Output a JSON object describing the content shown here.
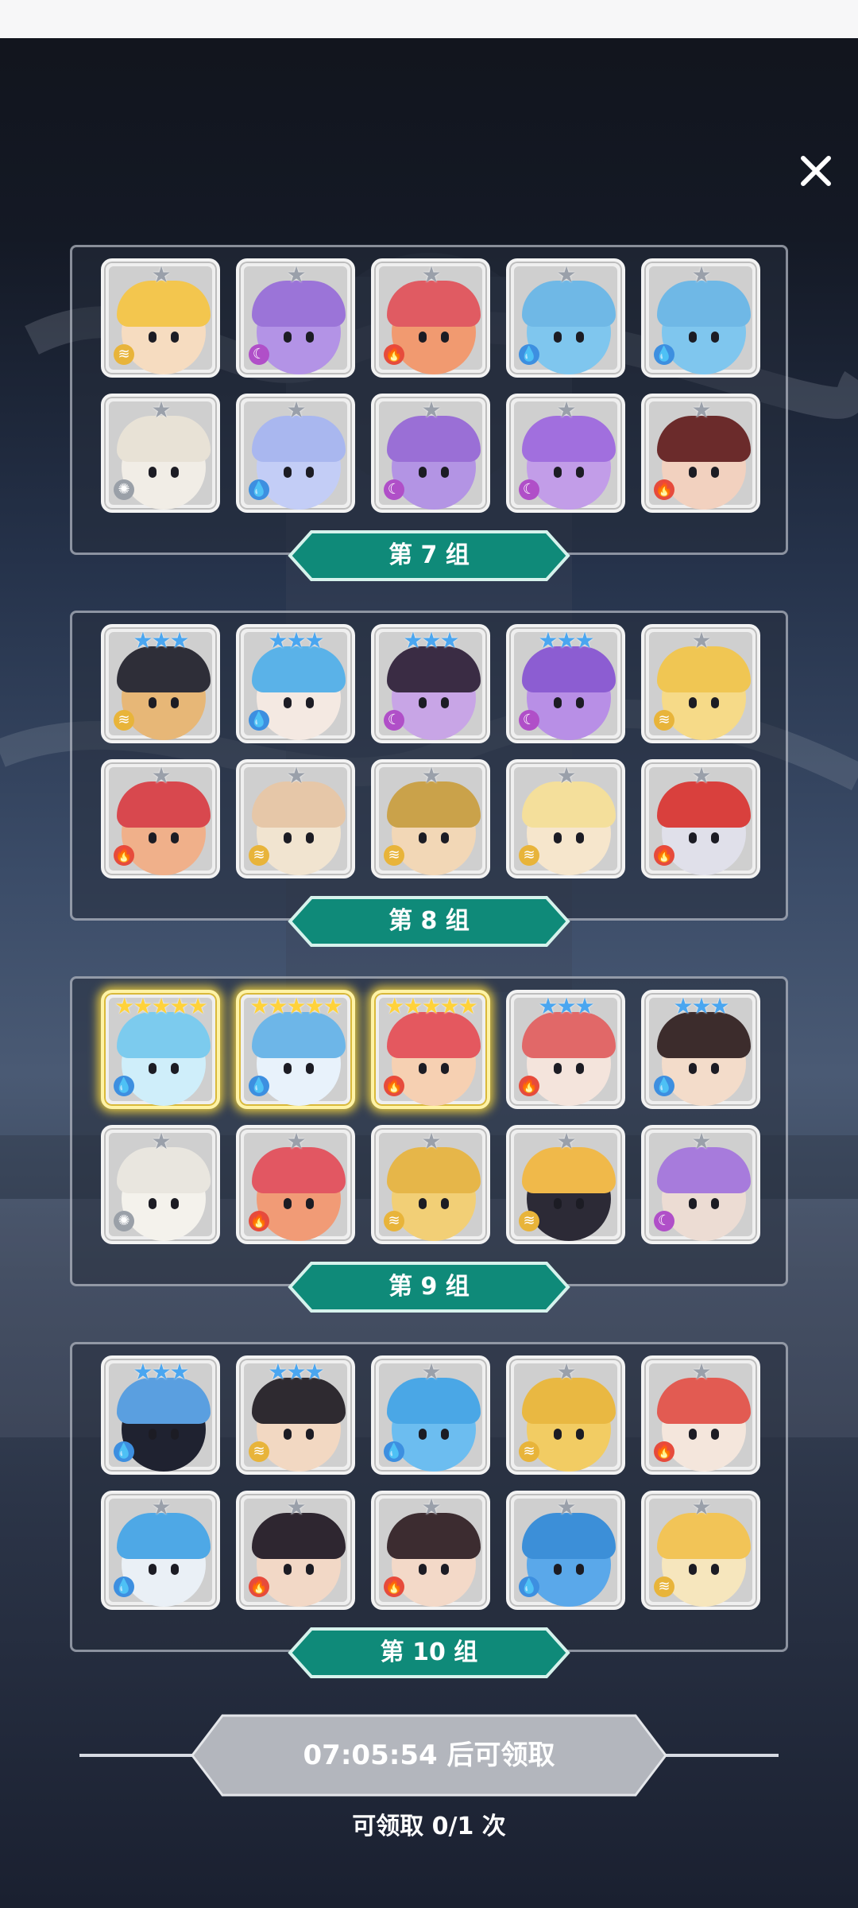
{
  "close_icon": "close-icon",
  "groups": [
    {
      "label": "第 7 组",
      "cards": [
        {
          "stars": "★",
          "element": "wind",
          "palette": [
            "#f3c64e",
            "#f6dcc0",
            "#e7a13a"
          ]
        },
        {
          "stars": "★",
          "element": "dark",
          "palette": [
            "#9b74d8",
            "#b393e6",
            "#7c55c0"
          ]
        },
        {
          "stars": "★",
          "element": "fire",
          "palette": [
            "#e05b62",
            "#f19a70",
            "#c94550"
          ]
        },
        {
          "stars": "★",
          "element": "water",
          "palette": [
            "#6fb8e6",
            "#7fc6ee",
            "#5aa1d6"
          ]
        },
        {
          "stars": "★",
          "element": "water",
          "palette": [
            "#6fb8e6",
            "#7fc6ee",
            "#5aa1d6"
          ]
        },
        {
          "stars": "★",
          "element": "light",
          "palette": [
            "#e8e2d6",
            "#f1ede6",
            "#cfc7b8"
          ]
        },
        {
          "stars": "★",
          "element": "water",
          "palette": [
            "#a9b7ef",
            "#c3cdf6",
            "#8a9be0"
          ]
        },
        {
          "stars": "★",
          "element": "dark",
          "palette": [
            "#9a6fd6",
            "#b394e4",
            "#7a52bd"
          ]
        },
        {
          "stars": "★",
          "element": "dark",
          "palette": [
            "#a16fde",
            "#c29de8",
            "#4a2d66"
          ]
        },
        {
          "stars": "★",
          "element": "fire",
          "palette": [
            "#6b2b2b",
            "#f2d1bf",
            "#d9463e"
          ]
        }
      ]
    },
    {
      "label": "第 8 组",
      "cards": [
        {
          "stars": "★★★",
          "element": "wind",
          "palette": [
            "#2e2e38",
            "#e7b777",
            "#f0d9b0"
          ]
        },
        {
          "stars": "★★★",
          "element": "water",
          "palette": [
            "#5ab2e8",
            "#f4e9e2",
            "#2e7fc0"
          ]
        },
        {
          "stars": "★★★",
          "element": "dark",
          "palette": [
            "#3a2c44",
            "#c8a5e6",
            "#8a5cc6"
          ]
        },
        {
          "stars": "★★★",
          "element": "dark",
          "palette": [
            "#8c5dd2",
            "#b88fe6",
            "#6b3fb0"
          ]
        },
        {
          "stars": "★",
          "element": "wind",
          "palette": [
            "#f0c653",
            "#f6da88",
            "#d6a733"
          ]
        },
        {
          "stars": "★",
          "element": "fire",
          "palette": [
            "#d8484e",
            "#f0b08a",
            "#b5363c"
          ]
        },
        {
          "stars": "★",
          "element": "wind",
          "palette": [
            "#e6c7a8",
            "#f1e4d0",
            "#c9a37f"
          ]
        },
        {
          "stars": "★",
          "element": "wind",
          "palette": [
            "#caa24a",
            "#f2d7b6",
            "#2f2f38"
          ]
        },
        {
          "stars": "★",
          "element": "wind",
          "palette": [
            "#f4df9b",
            "#f6e6cc",
            "#e6c768"
          ]
        },
        {
          "stars": "★",
          "element": "fire",
          "palette": [
            "#d9403d",
            "#e0e0ea",
            "#2e2e3c"
          ]
        }
      ]
    },
    {
      "label": "第 9 组",
      "cards": [
        {
          "stars": "★★★★★",
          "element": "water",
          "gold": true,
          "palette": [
            "#7ccbee",
            "#cfeefa",
            "#2e3c5a"
          ]
        },
        {
          "stars": "★★★★★",
          "element": "water",
          "gold": true,
          "palette": [
            "#6db6e8",
            "#e8f2fb",
            "#3b7fc1"
          ]
        },
        {
          "stars": "★★★★★",
          "element": "fire",
          "gold": true,
          "palette": [
            "#e4585f",
            "#f6d0b2",
            "#c23f48"
          ]
        },
        {
          "stars": "★★★",
          "element": "fire",
          "palette": [
            "#e16868",
            "#f4e4dc",
            "#c44b4b"
          ]
        },
        {
          "stars": "★★★",
          "element": "water",
          "palette": [
            "#3c2c2c",
            "#f3dcca",
            "#5d9ee0"
          ]
        },
        {
          "stars": "★",
          "element": "light",
          "palette": [
            "#e9e6df",
            "#f4f2ec",
            "#c9c4b8"
          ]
        },
        {
          "stars": "★",
          "element": "fire",
          "palette": [
            "#e25762",
            "#f19b76",
            "#c4424f"
          ]
        },
        {
          "stars": "★",
          "element": "wind",
          "palette": [
            "#e6b649",
            "#f2cf76",
            "#c99a2f"
          ]
        },
        {
          "stars": "★",
          "element": "wind",
          "palette": [
            "#f0b94a",
            "#2c2a36",
            "#d69b2c"
          ]
        },
        {
          "stars": "★",
          "element": "dark",
          "palette": [
            "#a77bdc",
            "#ecdcd3",
            "#7d4fc0"
          ]
        }
      ]
    },
    {
      "label": "第 10 组",
      "cards": [
        {
          "stars": "★★★",
          "element": "water",
          "palette": [
            "#5a9fe0",
            "#1f2230",
            "#3c7bc8"
          ]
        },
        {
          "stars": "★★★",
          "element": "wind",
          "palette": [
            "#2e2a30",
            "#f2d8c2",
            "#e6b84a"
          ]
        },
        {
          "stars": "★",
          "element": "water",
          "palette": [
            "#4aa7e6",
            "#6cbdf0",
            "#2f86cc"
          ]
        },
        {
          "stars": "★",
          "element": "wind",
          "palette": [
            "#e9b842",
            "#f2cc63",
            "#caa02e"
          ]
        },
        {
          "stars": "★",
          "element": "fire",
          "palette": [
            "#e25b52",
            "#f4e6dc",
            "#c24a44"
          ]
        },
        {
          "stars": "★",
          "element": "water",
          "palette": [
            "#4ea8e6",
            "#eaf0f6",
            "#2e72c0"
          ]
        },
        {
          "stars": "★",
          "element": "fire",
          "palette": [
            "#2e2630",
            "#f2d8c6",
            "#c73c3c"
          ]
        },
        {
          "stars": "★",
          "element": "fire",
          "palette": [
            "#3c2c30",
            "#f3d9c8",
            "#d64848"
          ]
        },
        {
          "stars": "★",
          "element": "water",
          "palette": [
            "#3c8fd8",
            "#5aa8ea",
            "#2a3a5a"
          ]
        },
        {
          "stars": "★",
          "element": "wind",
          "palette": [
            "#f2c457",
            "#f6e6bd",
            "#e0a83a"
          ]
        }
      ]
    }
  ],
  "footer": {
    "timer_text": "07:05:54 后可领取",
    "claim_text": "可领取 0/1 次"
  },
  "colors": {
    "banner": "#0f8a79",
    "banner_border": "#d6f2ec",
    "panel_border": "#e1e6f0",
    "timer_plate": "#b3b6bd"
  }
}
